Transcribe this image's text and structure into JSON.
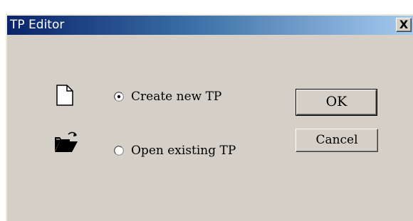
{
  "window": {
    "title": "TP Editor",
    "close_label": "X"
  },
  "options": {
    "create_new_label": "Create new TP",
    "open_existing_label": "Open existing TP",
    "selected": "create_new"
  },
  "buttons": {
    "ok_label": "OK",
    "cancel_label": "Cancel"
  },
  "icons": {
    "create_new": "new-document-icon",
    "open_existing": "open-folder-icon"
  },
  "colors": {
    "face": "#d4d0c8",
    "title_start": "#0a246a",
    "title_end": "#a6caf0"
  }
}
